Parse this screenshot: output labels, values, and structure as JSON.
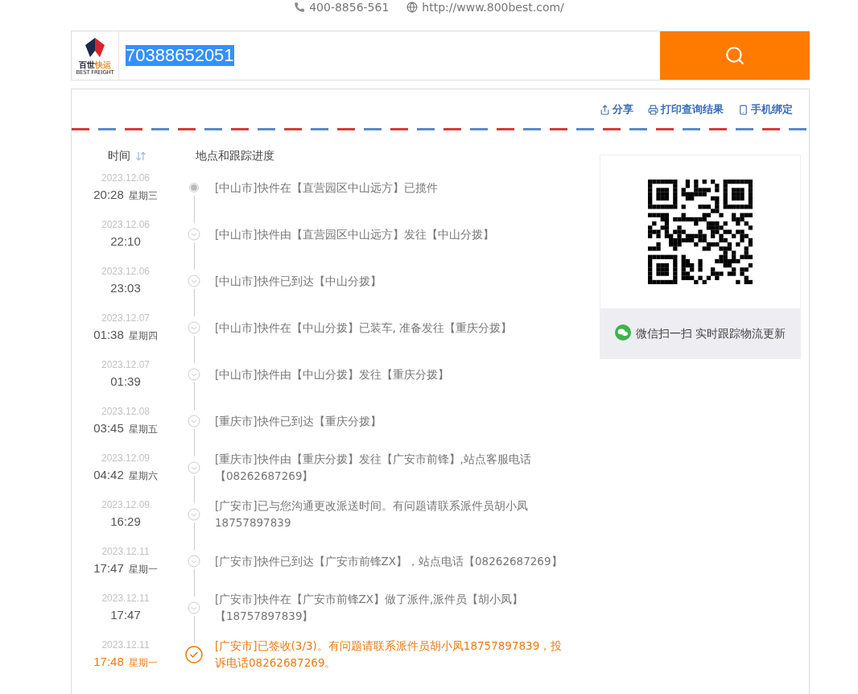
{
  "contact": {
    "phone": "400-8856-561",
    "website": "http://www.800best.com/"
  },
  "search": {
    "logo_cn_a": "百世",
    "logo_cn_b": "快运",
    "logo_en": "BEST FREIGHT",
    "value": "70388652051",
    "value_selected": true
  },
  "actions": [
    {
      "kind": "share",
      "label": "分享"
    },
    {
      "kind": "print",
      "label": "打印查询结果"
    },
    {
      "kind": "phone",
      "label": "手机绑定"
    }
  ],
  "columns": {
    "time": "时间",
    "progress": "地点和跟踪进度"
  },
  "events": [
    {
      "kind": "collected",
      "date": "2023.12.06",
      "time": "20:28",
      "weekday": "星期三",
      "text": "[中山市]快件在【直营园区中山远方】已揽件"
    },
    {
      "kind": "transit",
      "date": "2023.12.06",
      "time": "22:10",
      "text": "[中山市]快件由【直营园区中山远方】发往【中山分拨】"
    },
    {
      "kind": "transit",
      "date": "2023.12.06",
      "time": "23:03",
      "text": "[中山市]快件已到达【中山分拨】"
    },
    {
      "kind": "transit",
      "date": "2023.12.07",
      "time": "01:38",
      "weekday": "星期四",
      "text": "[中山市]快件在【中山分拨】已装车, 准备发往【重庆分拨】"
    },
    {
      "kind": "transit",
      "date": "2023.12.07",
      "time": "01:39",
      "text": "[中山市]快件由【中山分拨】发往【重庆分拨】"
    },
    {
      "kind": "transit",
      "date": "2023.12.08",
      "time": "03:45",
      "weekday": "星期五",
      "text": "[重庆市]快件已到达【重庆分拨】"
    },
    {
      "kind": "transit",
      "date": "2023.12.09",
      "time": "04:42",
      "weekday": "星期六",
      "text": "[重庆市]快件由【重庆分拨】发往【广安市前锋】,站点客服电话【08262687269】"
    },
    {
      "kind": "transit",
      "date": "2023.12.09",
      "time": "16:29",
      "text": "[广安市]已与您沟通更改派送时间。有问题请联系派件员胡小凤18757897839"
    },
    {
      "kind": "transit",
      "date": "2023.12.11",
      "time": "17:47",
      "weekday": "星期一",
      "text": "[广安市]快件已到达【广安市前锋ZX】，站点电话【08262687269】"
    },
    {
      "kind": "transit",
      "date": "2023.12.11",
      "time": "17:47",
      "text": "[广安市]快件在【广安市前锋ZX】做了派件,派件员【胡小凤】【18757897839】"
    },
    {
      "kind": "signed",
      "date": "2023.12.11",
      "time": "17:48",
      "weekday": "星期一",
      "text": "[广安市]已签收(3/3)。有问题请联系派件员胡小凤18757897839，投诉电话08262687269。"
    }
  ],
  "qr": {
    "caption": "微信扫一扫 实时跟踪物流更新"
  }
}
